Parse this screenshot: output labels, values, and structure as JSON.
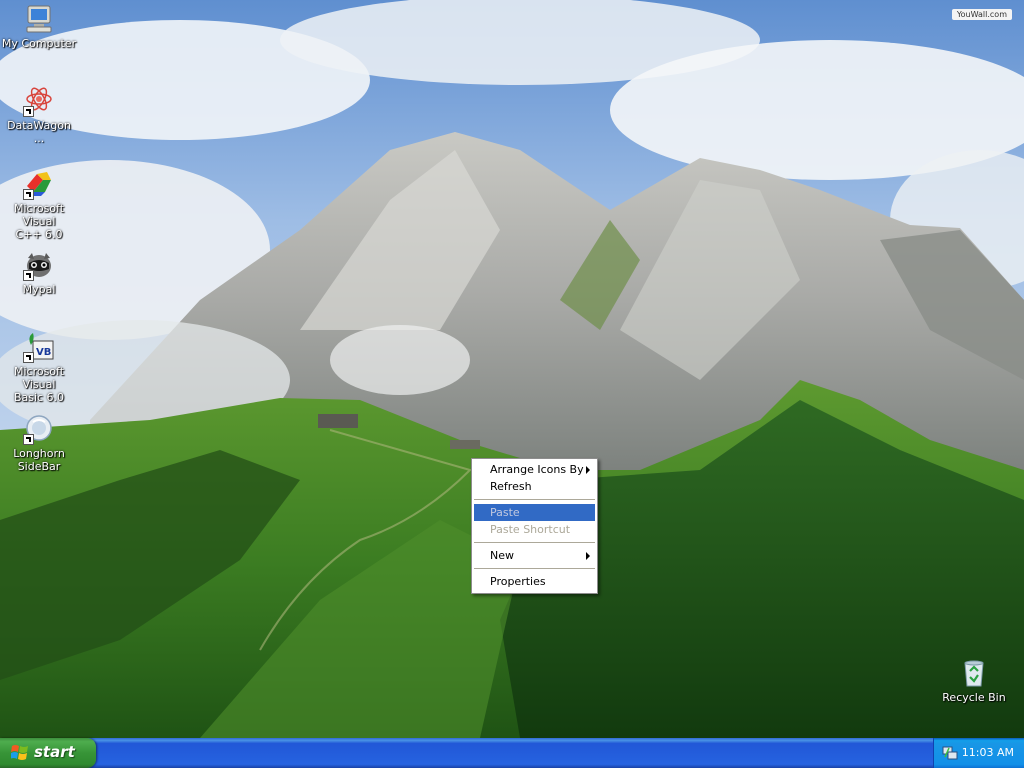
{
  "desktop": {
    "watermark": "YouWall.com",
    "icons": [
      {
        "label": "My Computer",
        "icon": "my-computer-icon"
      },
      {
        "label": "DataWagon ...",
        "icon": "datawagon-icon"
      },
      {
        "label": "Microsoft Visual\nC++ 6.0",
        "icon": "visual-cpp-icon"
      },
      {
        "label": "Mypal",
        "icon": "mypal-icon"
      },
      {
        "label": "Microsoft Visual\nBasic 6.0",
        "icon": "visual-basic-icon"
      },
      {
        "label": "Longhorn\nSideBar",
        "icon": "longhorn-sidebar-icon"
      }
    ],
    "recycle_bin": {
      "label": "Recycle Bin",
      "icon": "recycle-bin-icon"
    }
  },
  "context_menu": {
    "items": [
      {
        "label": "Arrange Icons By",
        "submenu": true,
        "enabled": true
      },
      {
        "label": "Refresh",
        "enabled": true
      },
      {
        "label": "Paste",
        "enabled": false,
        "highlighted": true
      },
      {
        "label": "Paste Shortcut",
        "enabled": false
      },
      {
        "label": "New",
        "submenu": true,
        "enabled": true
      },
      {
        "label": "Properties",
        "enabled": true
      }
    ]
  },
  "taskbar": {
    "start_label": "start",
    "clock": "11:03 AM",
    "colors": {
      "taskbar": "#2663e0",
      "start": "#379437",
      "tray": "#1290e8",
      "highlight": "#316ac5"
    }
  }
}
